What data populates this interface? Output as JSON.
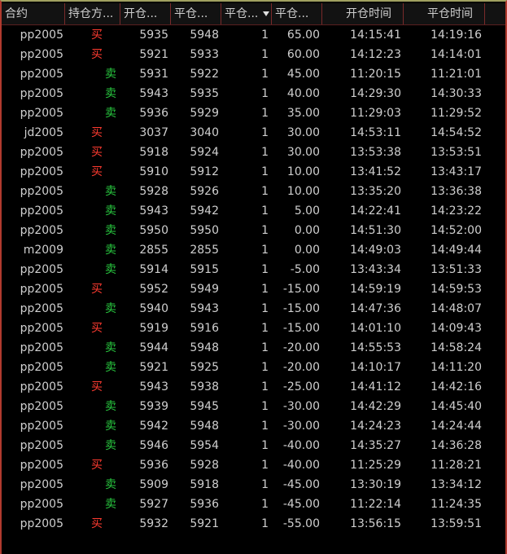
{
  "columns": {
    "symbol": "合约",
    "direction": "持仓方...",
    "open_price": "开仓...",
    "close_price": "平仓...",
    "quantity": "平仓...",
    "pnl": "平仓...",
    "open_time": "开仓时间",
    "close_time": "平仓时间"
  },
  "colors": {
    "buy": "#ff3b30",
    "sell": "#28c93f",
    "text": "#cfcfcf",
    "background": "#000000"
  },
  "rows": [
    {
      "symbol": "pp2005",
      "direction": "买",
      "open_price": "5935",
      "close_price": "5948",
      "quantity": "1",
      "pnl": "65.00",
      "open_time": "14:15:41",
      "close_time": "14:19:16"
    },
    {
      "symbol": "pp2005",
      "direction": "买",
      "open_price": "5921",
      "close_price": "5933",
      "quantity": "1",
      "pnl": "60.00",
      "open_time": "14:12:23",
      "close_time": "14:14:01"
    },
    {
      "symbol": "pp2005",
      "direction": "卖",
      "open_price": "5931",
      "close_price": "5922",
      "quantity": "1",
      "pnl": "45.00",
      "open_time": "11:20:15",
      "close_time": "11:21:01"
    },
    {
      "symbol": "pp2005",
      "direction": "卖",
      "open_price": "5943",
      "close_price": "5935",
      "quantity": "1",
      "pnl": "40.00",
      "open_time": "14:29:30",
      "close_time": "14:30:33"
    },
    {
      "symbol": "pp2005",
      "direction": "卖",
      "open_price": "5936",
      "close_price": "5929",
      "quantity": "1",
      "pnl": "35.00",
      "open_time": "11:29:03",
      "close_time": "11:29:52"
    },
    {
      "symbol": "jd2005",
      "direction": "买",
      "open_price": "3037",
      "close_price": "3040",
      "quantity": "1",
      "pnl": "30.00",
      "open_time": "14:53:11",
      "close_time": "14:54:52"
    },
    {
      "symbol": "pp2005",
      "direction": "买",
      "open_price": "5918",
      "close_price": "5924",
      "quantity": "1",
      "pnl": "30.00",
      "open_time": "13:53:38",
      "close_time": "13:53:51"
    },
    {
      "symbol": "pp2005",
      "direction": "买",
      "open_price": "5910",
      "close_price": "5912",
      "quantity": "1",
      "pnl": "10.00",
      "open_time": "13:41:52",
      "close_time": "13:43:17"
    },
    {
      "symbol": "pp2005",
      "direction": "卖",
      "open_price": "5928",
      "close_price": "5926",
      "quantity": "1",
      "pnl": "10.00",
      "open_time": "13:35:20",
      "close_time": "13:36:38"
    },
    {
      "symbol": "pp2005",
      "direction": "卖",
      "open_price": "5943",
      "close_price": "5942",
      "quantity": "1",
      "pnl": "5.00",
      "open_time": "14:22:41",
      "close_time": "14:23:22"
    },
    {
      "symbol": "pp2005",
      "direction": "卖",
      "open_price": "5950",
      "close_price": "5950",
      "quantity": "1",
      "pnl": "0.00",
      "open_time": "14:51:30",
      "close_time": "14:52:00"
    },
    {
      "symbol": "m2009",
      "direction": "卖",
      "open_price": "2855",
      "close_price": "2855",
      "quantity": "1",
      "pnl": "0.00",
      "open_time": "14:49:03",
      "close_time": "14:49:44"
    },
    {
      "symbol": "pp2005",
      "direction": "卖",
      "open_price": "5914",
      "close_price": "5915",
      "quantity": "1",
      "pnl": "-5.00",
      "open_time": "13:43:34",
      "close_time": "13:51:33"
    },
    {
      "symbol": "pp2005",
      "direction": "买",
      "open_price": "5952",
      "close_price": "5949",
      "quantity": "1",
      "pnl": "-15.00",
      "open_time": "14:59:19",
      "close_time": "14:59:53"
    },
    {
      "symbol": "pp2005",
      "direction": "卖",
      "open_price": "5940",
      "close_price": "5943",
      "quantity": "1",
      "pnl": "-15.00",
      "open_time": "14:47:36",
      "close_time": "14:48:07"
    },
    {
      "symbol": "pp2005",
      "direction": "买",
      "open_price": "5919",
      "close_price": "5916",
      "quantity": "1",
      "pnl": "-15.00",
      "open_time": "14:01:10",
      "close_time": "14:09:43"
    },
    {
      "symbol": "pp2005",
      "direction": "卖",
      "open_price": "5944",
      "close_price": "5948",
      "quantity": "1",
      "pnl": "-20.00",
      "open_time": "14:55:53",
      "close_time": "14:58:24"
    },
    {
      "symbol": "pp2005",
      "direction": "卖",
      "open_price": "5921",
      "close_price": "5925",
      "quantity": "1",
      "pnl": "-20.00",
      "open_time": "14:10:17",
      "close_time": "14:11:20"
    },
    {
      "symbol": "pp2005",
      "direction": "买",
      "open_price": "5943",
      "close_price": "5938",
      "quantity": "1",
      "pnl": "-25.00",
      "open_time": "14:41:12",
      "close_time": "14:42:16"
    },
    {
      "symbol": "pp2005",
      "direction": "卖",
      "open_price": "5939",
      "close_price": "5945",
      "quantity": "1",
      "pnl": "-30.00",
      "open_time": "14:42:29",
      "close_time": "14:45:40"
    },
    {
      "symbol": "pp2005",
      "direction": "卖",
      "open_price": "5942",
      "close_price": "5948",
      "quantity": "1",
      "pnl": "-30.00",
      "open_time": "14:24:23",
      "close_time": "14:24:44"
    },
    {
      "symbol": "pp2005",
      "direction": "卖",
      "open_price": "5946",
      "close_price": "5954",
      "quantity": "1",
      "pnl": "-40.00",
      "open_time": "14:35:27",
      "close_time": "14:36:28"
    },
    {
      "symbol": "pp2005",
      "direction": "买",
      "open_price": "5936",
      "close_price": "5928",
      "quantity": "1",
      "pnl": "-40.00",
      "open_time": "11:25:29",
      "close_time": "11:28:21"
    },
    {
      "symbol": "pp2005",
      "direction": "卖",
      "open_price": "5909",
      "close_price": "5918",
      "quantity": "1",
      "pnl": "-45.00",
      "open_time": "13:30:19",
      "close_time": "13:34:12"
    },
    {
      "symbol": "pp2005",
      "direction": "卖",
      "open_price": "5927",
      "close_price": "5936",
      "quantity": "1",
      "pnl": "-45.00",
      "open_time": "11:22:14",
      "close_time": "11:24:35"
    },
    {
      "symbol": "pp2005",
      "direction": "买",
      "open_price": "5932",
      "close_price": "5921",
      "quantity": "1",
      "pnl": "-55.00",
      "open_time": "13:56:15",
      "close_time": "13:59:51"
    }
  ]
}
